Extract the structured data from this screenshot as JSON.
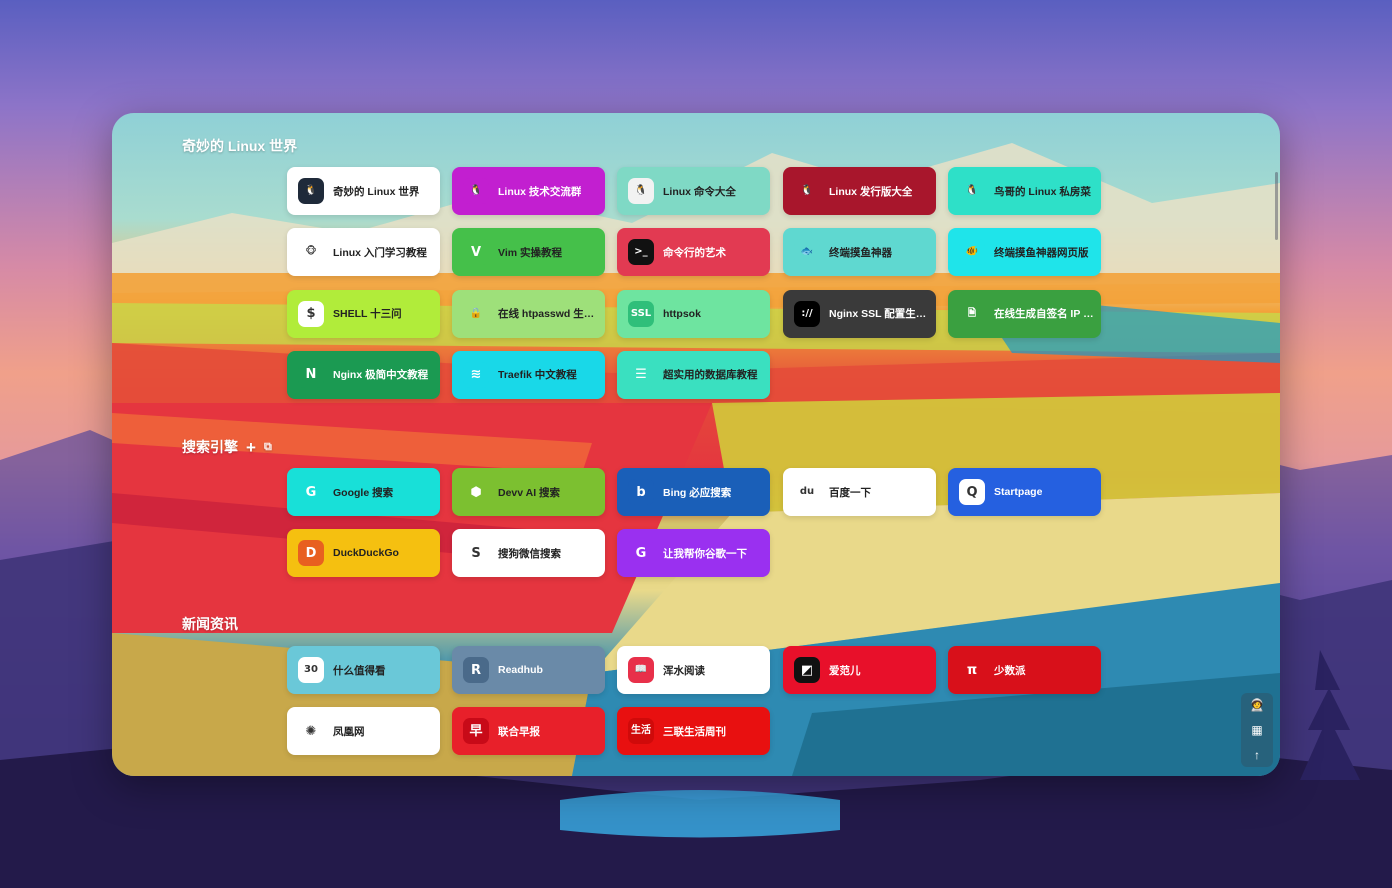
{
  "sections": [
    {
      "title": "奇妙的 Linux 世界",
      "cards": [
        {
          "label": "奇妙的 Linux 世界",
          "bg": "#ffffff",
          "icon_bg": "#1f2a3a",
          "glyph": "🐧",
          "icon": "penguin-icon",
          "theme": "light"
        },
        {
          "label": "Linux 技术交流群",
          "bg": "#c21fd0",
          "icon_bg": "#c21fd0",
          "glyph": "🐧",
          "icon": "penguin-icon",
          "theme": "dark"
        },
        {
          "label": "Linux 命令大全",
          "bg": "#7fd9c5",
          "icon_bg": "#f2f2f2",
          "glyph": "🐧",
          "icon": "penguin-icon",
          "theme": "light"
        },
        {
          "label": "Linux 发行版大全",
          "bg": "#a8162c",
          "icon_bg": "#a8162c",
          "glyph": "🐧",
          "icon": "penguin-icon",
          "theme": "dark"
        },
        {
          "label": "鸟哥的 Linux 私房菜",
          "bg": "#2ee0c8",
          "icon_bg": "#2ee0c8",
          "glyph": "🐧",
          "icon": "penguin-icon",
          "theme": "light"
        },
        {
          "label": "Linux 入门学习教程",
          "bg": "#ffffff",
          "icon_bg": "#ffffff",
          "glyph": "🐵",
          "icon": "monkey-icon",
          "theme": "light"
        },
        {
          "label": "Vim 实操教程",
          "bg": "#45c04a",
          "icon_bg": "#45c04a",
          "glyph": "V",
          "icon": "vim-icon",
          "theme": "light"
        },
        {
          "label": "命令行的艺术",
          "bg": "#e23a52",
          "icon_bg": "#111111",
          "glyph": ">_",
          "icon": "terminal-icon",
          "theme": "dark"
        },
        {
          "label": "终端摸鱼神器",
          "bg": "#5fd8d0",
          "icon_bg": "#5fd8d0",
          "glyph": "🐟",
          "icon": "fish-icon",
          "theme": "light"
        },
        {
          "label": "终端摸鱼神器网页版",
          "bg": "#1fe4ea",
          "icon_bg": "#1fe4ea",
          "glyph": "🐠",
          "icon": "fish-icon",
          "theme": "light"
        },
        {
          "label": "SHELL 十三问",
          "bg": "#b1ec3a",
          "icon_bg": "#ffffff",
          "glyph": "$",
          "icon": "shell-cube-icon",
          "theme": "light"
        },
        {
          "label": "在线 htpasswd 生成器",
          "bg": "#9ee07a",
          "icon_bg": "#9ee07a",
          "glyph": "🔒",
          "icon": "lock-icon",
          "theme": "light"
        },
        {
          "label": "httpsok",
          "bg": "#6ee4a0",
          "icon_bg": "#2fbf7a",
          "glyph": "SSL",
          "icon": "ssl-shield-icon",
          "theme": "light"
        },
        {
          "label": "Nginx SSL 配置生成器",
          "bg": "#3a3a3a",
          "icon_bg": "#000000",
          "glyph": "://",
          "icon": "ssl-config-icon",
          "theme": "dark"
        },
        {
          "label": "在线生成自签名 IP 证书",
          "bg": "#3aa040",
          "icon_bg": "#3aa040",
          "glyph": "🗎",
          "icon": "certificate-icon",
          "theme": "dark"
        },
        {
          "label": "Nginx 极简中文教程",
          "bg": "#1b9a52",
          "icon_bg": "#1b9a52",
          "glyph": "N",
          "icon": "nginx-icon",
          "theme": "dark"
        },
        {
          "label": "Traefik 中文教程",
          "bg": "#19d8e8",
          "icon_bg": "#19d8e8",
          "glyph": "≋",
          "icon": "traefik-icon",
          "theme": "light"
        },
        {
          "label": "超实用的数据库教程",
          "bg": "#3ae0c0",
          "icon_bg": "#3ae0c0",
          "glyph": "☰",
          "icon": "database-icon",
          "theme": "light"
        }
      ]
    },
    {
      "title": "搜索引擎",
      "plus": "+",
      "mini": "⧉",
      "cards": [
        {
          "label": "Google 搜索",
          "bg": "#18e0d8",
          "icon_bg": "#18e0d8",
          "glyph": "G",
          "icon": "google-icon",
          "theme": "light"
        },
        {
          "label": "Devv AI 搜索",
          "bg": "#7cc030",
          "icon_bg": "#7cc030",
          "glyph": "⬢",
          "icon": "devv-cube-icon",
          "theme": "light"
        },
        {
          "label": "Bing 必应搜索",
          "bg": "#1a5fb8",
          "icon_bg": "#1a5fb8",
          "glyph": "b",
          "icon": "bing-icon",
          "theme": "dark"
        },
        {
          "label": "百度一下",
          "bg": "#ffffff",
          "icon_bg": "#ffffff",
          "glyph": "du",
          "icon": "baidu-paw-icon",
          "theme": "light"
        },
        {
          "label": "Startpage",
          "bg": "#2560e0",
          "icon_bg": "#ffffff",
          "glyph": "Q",
          "icon": "startpage-icon",
          "theme": "dark"
        },
        {
          "label": "DuckDuckGo",
          "bg": "#f5c010",
          "icon_bg": "#e86020",
          "glyph": "D",
          "icon": "duck-icon",
          "theme": "light"
        },
        {
          "label": "搜狗微信搜索",
          "bg": "#ffffff",
          "icon_bg": "#ffffff",
          "glyph": "S",
          "icon": "sogou-icon",
          "theme": "light"
        },
        {
          "label": "让我帮你谷歌一下",
          "bg": "#9a30f0",
          "icon_bg": "#9a30f0",
          "glyph": "G",
          "icon": "google-icon",
          "theme": "dark"
        }
      ]
    },
    {
      "title": "新闻资讯",
      "cards": [
        {
          "label": "什么值得看",
          "bg": "#6ac8d8",
          "icon_bg": "#ffffff",
          "glyph": "30",
          "icon": "number-30-icon",
          "theme": "light"
        },
        {
          "label": "Readhub",
          "bg": "#6a8aa8",
          "icon_bg": "#4a6a8a",
          "glyph": "R",
          "icon": "readhub-icon",
          "theme": "dark"
        },
        {
          "label": "浑水阅读",
          "bg": "#ffffff",
          "icon_bg": "#e8304a",
          "glyph": "📖",
          "icon": "book-icon",
          "theme": "light"
        },
        {
          "label": "爱范儿",
          "bg": "#e8102a",
          "icon_bg": "#111111",
          "glyph": "◩",
          "icon": "ifanr-icon",
          "theme": "dark"
        },
        {
          "label": "少数派",
          "bg": "#d8101a",
          "icon_bg": "#d8101a",
          "glyph": "π",
          "icon": "pi-icon",
          "theme": "dark"
        },
        {
          "label": "凤凰网",
          "bg": "#ffffff",
          "icon_bg": "#ffffff",
          "glyph": "✺",
          "icon": "phoenix-icon",
          "theme": "light"
        },
        {
          "label": "联合早报",
          "bg": "#e8202a",
          "icon_bg": "#c80a18",
          "glyph": "早",
          "icon": "zaobao-icon",
          "theme": "dark"
        },
        {
          "label": "三联生活周刊",
          "bg": "#e81010",
          "icon_bg": "#d00a0a",
          "glyph": "生活",
          "icon": "sanlian-icon",
          "theme": "dark"
        }
      ]
    }
  ],
  "tools": {
    "theme": "🧑‍🚀",
    "grid": "▦",
    "top": "↑"
  }
}
